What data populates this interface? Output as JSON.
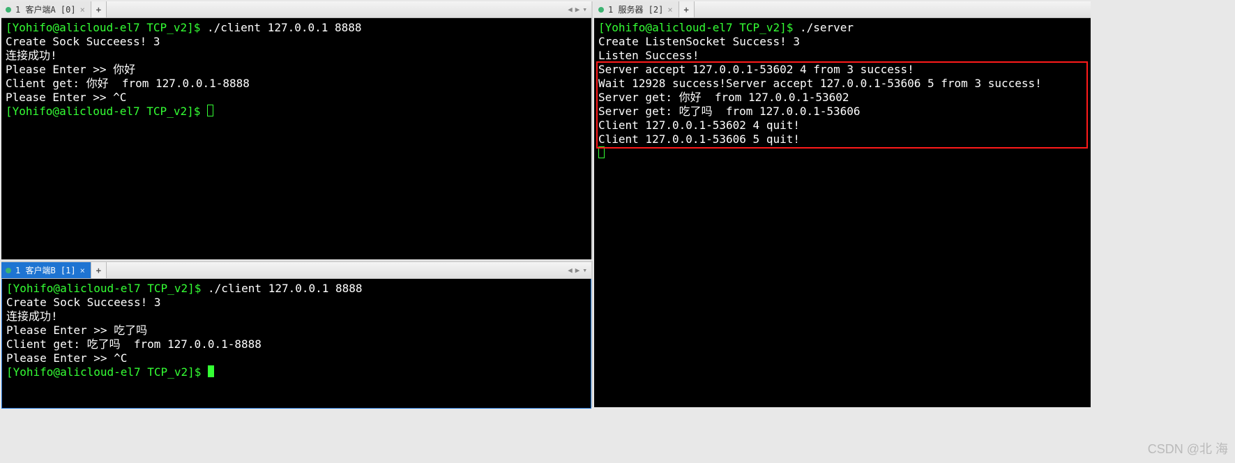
{
  "watermark": "CSDN @北   海",
  "panes": {
    "topleft": {
      "tab": "1 客户端A [0]",
      "add": "+",
      "arrows": {
        "left": "◀",
        "right": "▶",
        "down": "▾"
      },
      "lines": {
        "l0_prompt": "[Yohifo@alicloud-el7 TCP_v2]$ ",
        "l0_cmd": "./client 127.0.0.1 8888",
        "l1": "Create Sock Succeess! 3",
        "l2": "连接成功!",
        "l3": "Please Enter >> 你好",
        "l4": "Client get: 你好  from 127.0.0.1-8888",
        "l5": "Please Enter >> ^C",
        "l6_prompt": "[Yohifo@alicloud-el7 TCP_v2]$ "
      }
    },
    "bottomleft": {
      "tab": "1 客户端B [1]",
      "add": "+",
      "arrows": {
        "left": "◀",
        "right": "▶",
        "down": "▾"
      },
      "lines": {
        "l0_prompt": "[Yohifo@alicloud-el7 TCP_v2]$ ",
        "l0_cmd": "./client 127.0.0.1 8888",
        "l1": "Create Sock Succeess! 3",
        "l2": "连接成功!",
        "l3": "Please Enter >> 吃了吗",
        "l4": "Client get: 吃了吗  from 127.0.0.1-8888",
        "l5": "Please Enter >> ^C",
        "l6_prompt": "[Yohifo@alicloud-el7 TCP_v2]$ "
      }
    },
    "right": {
      "tab": "1 服务器 [2]",
      "add": "+",
      "lines": {
        "l0_prompt": "[Yohifo@alicloud-el7 TCP_v2]$ ",
        "l0_cmd": "./server",
        "l1": "Create ListenSocket Success! 3",
        "l2": "Listen Success!",
        "l3": "Server accept 127.0.0.1-53602 4 from 3 success!",
        "l4": "Wait 12928 success!Server accept 127.0.0.1-53606 5 from 3 success!",
        "l5": "Server get: 你好  from 127.0.0.1-53602",
        "l6": "Server get: 吃了吗  from 127.0.0.1-53606",
        "l7": "Client 127.0.0.1-53602 4 quit!",
        "l8": "Client 127.0.0.1-53606 5 quit!"
      }
    }
  }
}
